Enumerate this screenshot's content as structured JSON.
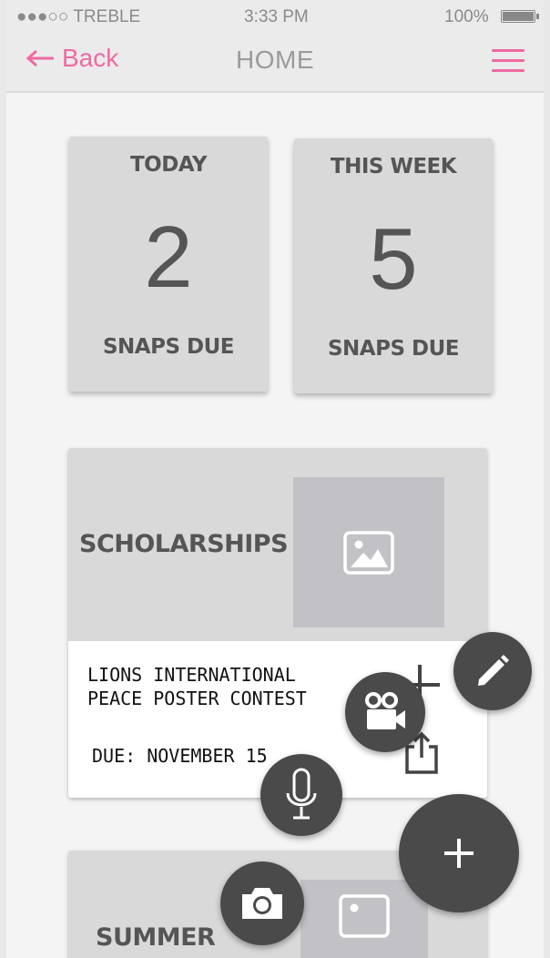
{
  "status_bar": {
    "carrier": "●●●○○ TREBLE",
    "time": "3:33 PM",
    "battery": "100%"
  },
  "nav": {
    "back_label": "Back",
    "title": "HOME"
  },
  "stats": [
    {
      "heading": "TODAY",
      "count": "2",
      "label": "SNAPS DUE"
    },
    {
      "heading": "THIS WEEK",
      "count": "5",
      "label": "SNAPS DUE"
    }
  ],
  "categories": [
    {
      "title": "SCHOLARSHIPS",
      "item": {
        "title": "LIONS INTERNATIONAL PEACE POSTER CONTEST",
        "due": "DUE: NOVEMBER 15"
      }
    },
    {
      "title": "SUMMER"
    }
  ],
  "fab_menu": [
    "pencil-icon",
    "video-camera-icon",
    "microphone-icon",
    "camera-icon",
    "plus-icon"
  ],
  "colors": {
    "accent": "#ef6aa3",
    "card": "#d9d9d9",
    "fab": "#4a4a4a",
    "placeholder": "#c2c1c6"
  }
}
